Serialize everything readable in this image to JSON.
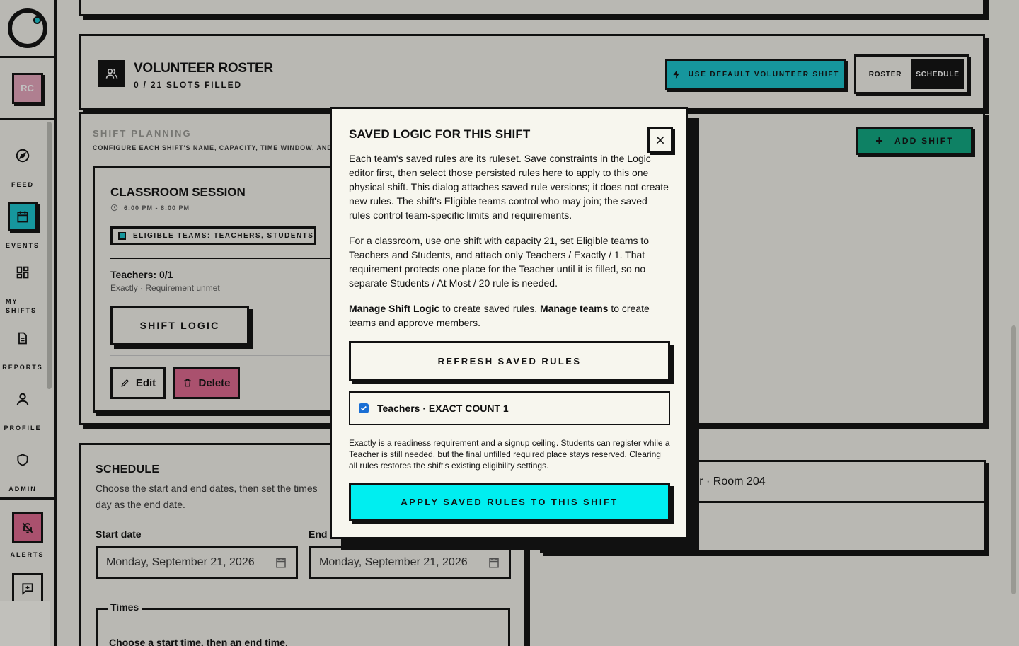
{
  "sidebar": {
    "avatar_initials": "RC",
    "items": [
      {
        "label": "FEED",
        "icon": "compass-icon"
      },
      {
        "label": "EVENTS",
        "icon": "calendar-icon",
        "active": true
      },
      {
        "label": "MY SHIFTS",
        "icon": "grid-icon"
      },
      {
        "label": "REPORTS",
        "icon": "document-icon"
      },
      {
        "label": "PROFILE",
        "icon": "user-icon"
      },
      {
        "label": "ADMIN",
        "icon": "shield-icon"
      }
    ],
    "alerts_label": "ALERTS"
  },
  "roster": {
    "title": "VOLUNTEER ROSTER",
    "subtitle": "0 / 21 SLOTS FILLED",
    "default_button": "USE DEFAULT VOLUNTEER SHIFT",
    "toggle": {
      "roster": "ROSTER",
      "schedule": "SCHEDULE",
      "selected": "SCHEDULE"
    }
  },
  "planning": {
    "title": "SHIFT PLANNING",
    "subtitle": "CONFIGURE EACH SHIFT'S NAME, CAPACITY, TIME WINDOW, AND",
    "add_shift": "ADD SHIFT",
    "shift": {
      "title": "CLASSROOM SESSION",
      "time": "6:00 PM - 8:00 PM",
      "eligible": "ELIGIBLE TEAMS: TEACHERS, STUDENTS",
      "requirement_line": "Teachers: 0/1",
      "requirement_status": "Exactly · Requirement unmet",
      "logic_button": "SHIFT LOGIC",
      "edit": "Edit",
      "delete": "Delete"
    }
  },
  "schedule": {
    "title": "SCHEDULE",
    "description": "Choose the start and end dates, then set the times day as the end date.",
    "start_label": "Start date",
    "end_label": "End",
    "start_value": "Monday, September 21, 2026",
    "end_value": "Monday, September 21, 2026",
    "times_legend": "Times",
    "times_desc": "Choose a start time, then an end time."
  },
  "location": {
    "row": "nter · Room 204"
  },
  "modal": {
    "title": "SAVED LOGIC FOR THIS SHIFT",
    "para1": "Each team's saved rules are its ruleset. Save constraints in the Logic editor first, then select those persisted rules here to apply to this one physical shift. This dialog attaches saved rule versions; it does not create new rules. The shift's Eligible teams control who may join; the saved rules control team-specific limits and requirements.",
    "para2": "For a classroom, use one shift with capacity 21, set Eligible teams to Teachers and Students, and attach only Teachers / Exactly / 1. That requirement protects one place for the Teacher until it is filled, so no separate Students / At Most / 20 rule is needed.",
    "links": {
      "manage_logic": "Manage Shift Logic",
      "logic_suffix": " to create saved rules. ",
      "manage_teams": "Manage teams",
      "teams_suffix": " to create teams and approve members."
    },
    "refresh_button": "REFRESH SAVED RULES",
    "rule": {
      "label": "Teachers · EXACT COUNT 1",
      "checked": true
    },
    "note": "Exactly is a readiness requirement and a signup ceiling. Students can register while a Teacher is still needed, but the final unfilled required place stays reserved. Clearing all rules restores the shift's existing eligibility settings.",
    "apply_button": "APPLY SAVED RULES TO THIS SHIFT"
  },
  "colors": {
    "accent_cyan": "#00eef0",
    "teal": "#19c6cf",
    "green": "#0ea982",
    "pink": "#e0698f",
    "ink": "#111111",
    "paper": "#f7f6ee"
  }
}
